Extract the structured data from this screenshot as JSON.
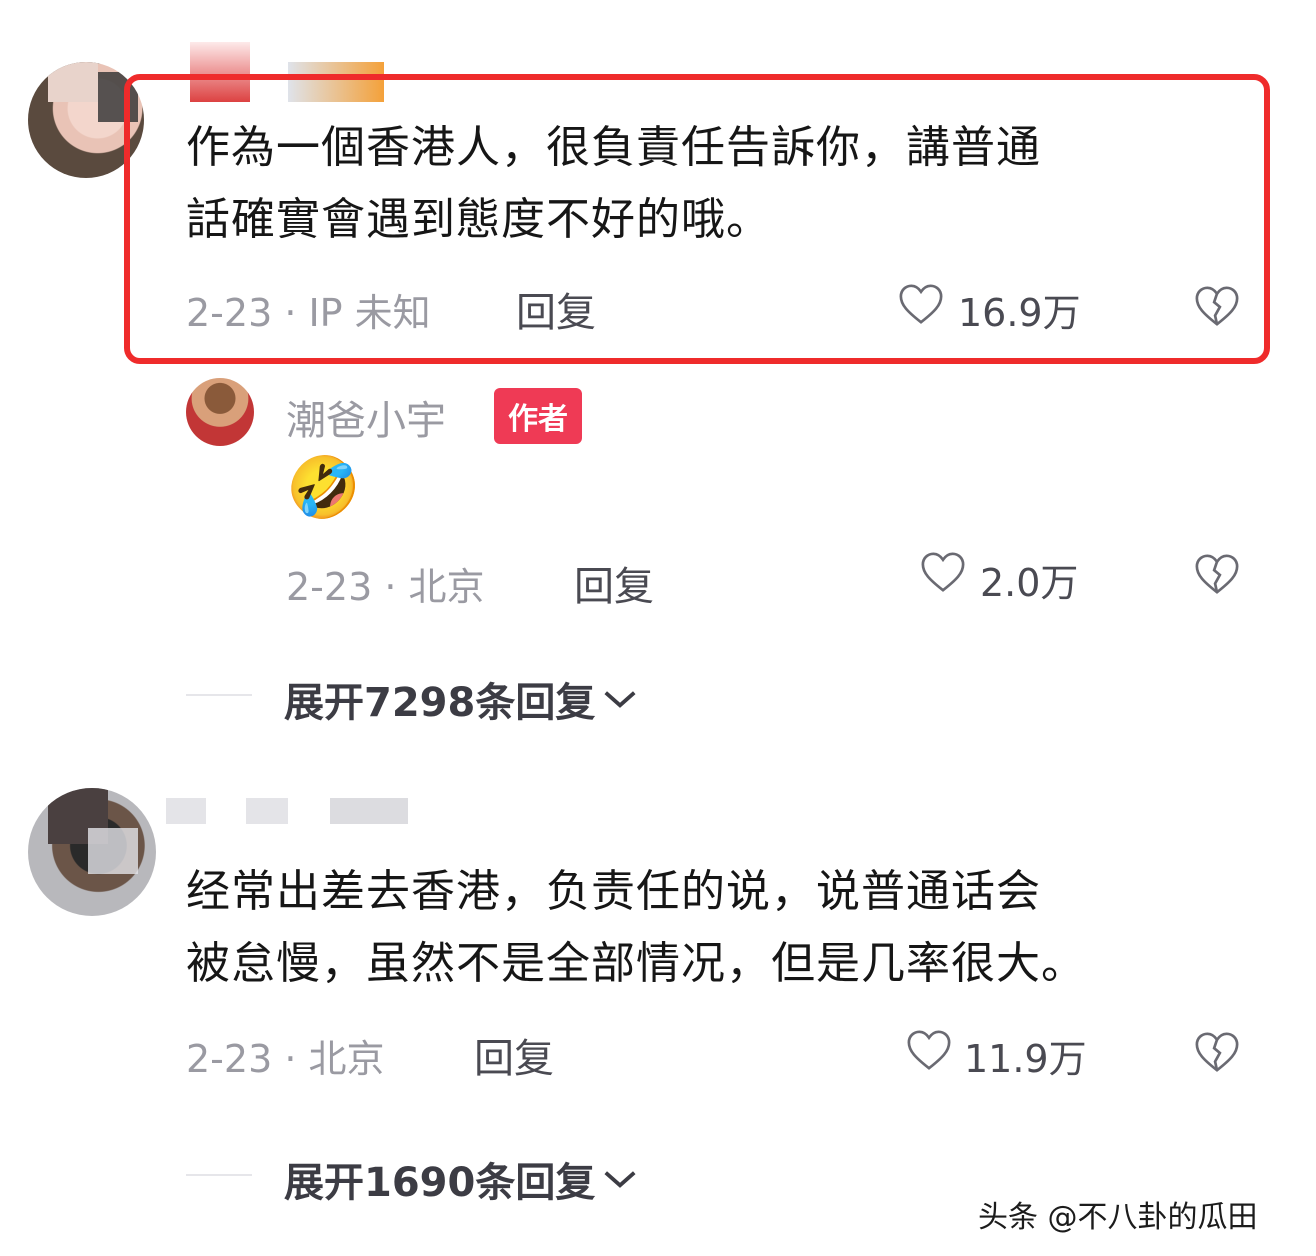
{
  "comments": [
    {
      "text_line1": "作為一個香港人，很負責任告訴你，講普通",
      "text_line2": "話確實會遇到態度不好的哦。",
      "date": "2-23 · IP 未知",
      "reply_label": "回复",
      "likes": "16.9万",
      "highlighted": true
    },
    {
      "author": "潮爸小宇",
      "badge": "作者",
      "emoji": "🤣",
      "date": "2-23 · 北京",
      "reply_label": "回复",
      "likes": "2.0万"
    },
    {
      "text_line1": "经常出差去香港，负责任的说，说普通话会",
      "text_line2": "被怠慢，虽然不是全部情况，但是几率很大。",
      "date": "2-23 · 北京",
      "reply_label": "回复",
      "likes": "11.9万"
    }
  ],
  "expand_replies": [
    {
      "label": "展开7298条回复"
    },
    {
      "label": "展开1690条回复"
    }
  ],
  "watermark": "头条 @不八卦的瓜田",
  "colors": {
    "highlight_border": "#ef2b2b",
    "badge": "#ef3a55",
    "meta_gray": "#9a9aa2"
  },
  "icons": {
    "like": "heart-outline-icon",
    "dislike": "broken-heart-icon",
    "expand": "chevron-down-icon"
  }
}
